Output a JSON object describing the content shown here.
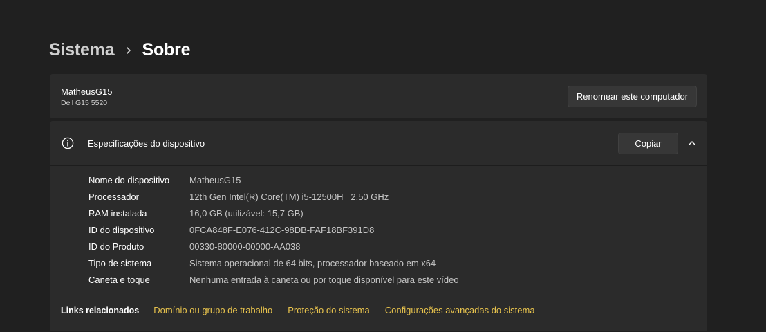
{
  "breadcrumb": {
    "parent": "Sistema",
    "current": "Sobre"
  },
  "device": {
    "name": "MatheusG15",
    "model": "Dell G15 5520",
    "rename_button": "Renomear este computador"
  },
  "specs": {
    "title": "Especificações do dispositivo",
    "copy_button": "Copiar",
    "rows": [
      {
        "label": "Nome do dispositivo",
        "value": "MatheusG15"
      },
      {
        "label": "Processador",
        "value": "12th Gen Intel(R) Core(TM) i5-12500H   2.50 GHz"
      },
      {
        "label": "RAM instalada",
        "value": "16,0 GB (utilizável: 15,7 GB)"
      },
      {
        "label": "ID do dispositivo",
        "value": "0FCA848F-E076-412C-98DB-FAF18BF391D8"
      },
      {
        "label": "ID do Produto",
        "value": "00330-80000-00000-AA038"
      },
      {
        "label": "Tipo de sistema",
        "value": "Sistema operacional de 64 bits, processador baseado em x64"
      },
      {
        "label": "Caneta e toque",
        "value": "Nenhuma entrada à caneta ou por toque disponível para este vídeo"
      }
    ]
  },
  "related_links": {
    "label": "Links relacionados",
    "links": [
      "Domínio ou grupo de trabalho",
      "Proteção do sistema",
      "Configurações avançadas do sistema"
    ]
  },
  "colors": {
    "background": "#202020",
    "card": "#2b2b2b",
    "link": "#e8c34d"
  },
  "icons": {
    "breadcrumb_separator": "chevron-right-icon",
    "specs": "info-icon",
    "collapse": "chevron-up-icon"
  }
}
